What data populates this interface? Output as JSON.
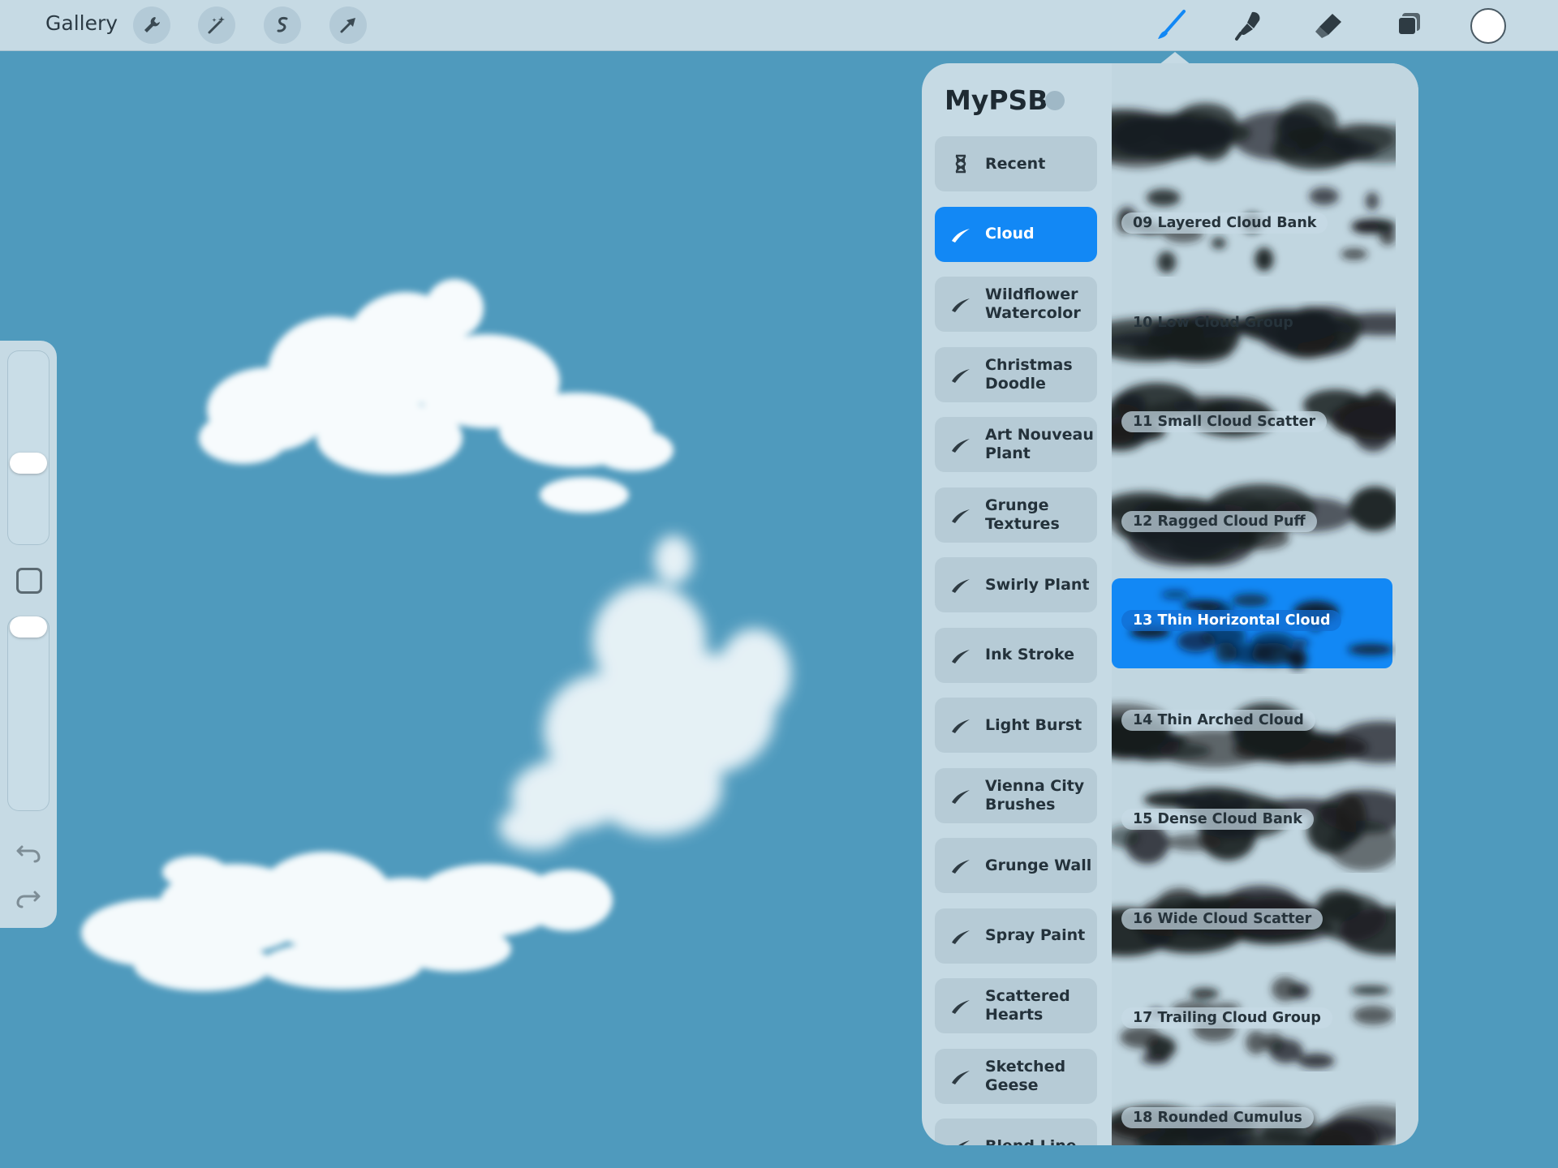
{
  "toolbar": {
    "gallery_label": "Gallery",
    "left_tools": [
      "wrench-icon",
      "magic-wand-icon",
      "selection-icon",
      "transform-arrow-icon"
    ],
    "right_tools": [
      "brush-icon",
      "smudge-icon",
      "eraser-icon",
      "layers-icon"
    ],
    "active_tool": "brush-icon",
    "current_color": "#ffffff"
  },
  "colors": {
    "canvas": "#4f9abd",
    "panel": "#c6dae4",
    "accent": "#1288f5"
  },
  "library": {
    "title": "MyPSB",
    "add_icon": "plus-icon",
    "sets": [
      {
        "label": "Recent",
        "icon": "hourglass-icon",
        "active": false
      },
      {
        "label": "Cloud",
        "icon": "brush-stroke-icon",
        "active": true
      },
      {
        "label": "Wildflower Watercolor",
        "icon": "brush-stroke-icon",
        "active": false
      },
      {
        "label": "Christmas Doodle",
        "icon": "brush-stroke-icon",
        "active": false
      },
      {
        "label": "Art Nouveau Plant",
        "icon": "brush-stroke-icon",
        "active": false
      },
      {
        "label": "Grunge Textures",
        "icon": "brush-stroke-icon",
        "active": false
      },
      {
        "label": "Swirly Plant",
        "icon": "brush-stroke-icon",
        "active": false
      },
      {
        "label": "Ink Stroke",
        "icon": "brush-stroke-icon",
        "active": false
      },
      {
        "label": "Light Burst",
        "icon": "brush-stroke-icon",
        "active": false
      },
      {
        "label": "Vienna City Brushes",
        "icon": "brush-stroke-icon",
        "active": false
      },
      {
        "label": "Grunge Wall",
        "icon": "brush-stroke-icon",
        "active": false
      },
      {
        "label": "Spray Paint",
        "icon": "brush-stroke-icon",
        "active": false
      },
      {
        "label": "Scattered Hearts",
        "icon": "brush-stroke-icon",
        "active": false
      },
      {
        "label": "Sketched Geese",
        "icon": "brush-stroke-icon",
        "active": false
      },
      {
        "label": "Blend Line",
        "icon": "brush-stroke-icon",
        "active": false
      }
    ],
    "brushes": [
      {
        "label": "",
        "selected": false
      },
      {
        "label": "09 Layered Cloud Bank",
        "selected": false
      },
      {
        "label": "10 Low Cloud Group",
        "selected": false
      },
      {
        "label": "11 Small Cloud Scatter",
        "selected": false
      },
      {
        "label": "12 Ragged Cloud Puff",
        "selected": false
      },
      {
        "label": "13 Thin Horizontal Cloud",
        "selected": true
      },
      {
        "label": "14 Thin Arched Cloud",
        "selected": false
      },
      {
        "label": "15 Dense Cloud Bank",
        "selected": false
      },
      {
        "label": "16 Wide Cloud Scatter",
        "selected": false
      },
      {
        "label": "17 Trailing Cloud Group",
        "selected": false
      },
      {
        "label": "18 Rounded Cumulus",
        "selected": false
      }
    ]
  },
  "sidebar": {
    "brush_size": 0.4,
    "opacity": 1.0,
    "undo_icon": "undo-icon",
    "redo_icon": "redo-icon",
    "modifier_icon": "modifier-square-icon"
  }
}
